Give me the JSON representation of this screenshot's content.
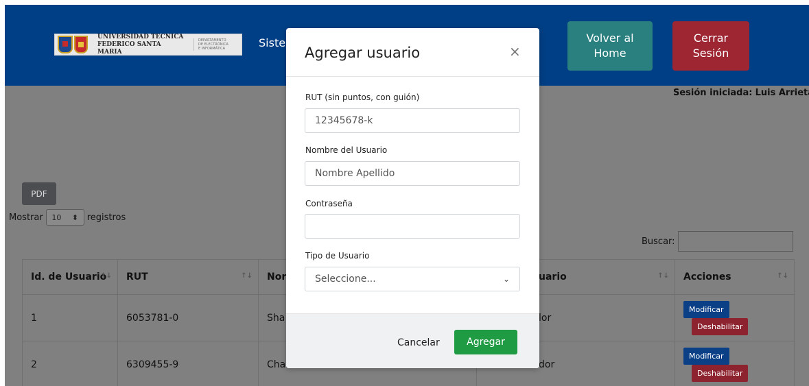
{
  "header": {
    "university_line1": "UNIVERSIDAD TECNICA",
    "university_line2": "FEDERICO SANTA MARIA",
    "department_line1": "DEPARTAMENTO",
    "department_line2": "DE ELECTRÓNICA",
    "department_line3": "E INFORMÁTICA",
    "nav_partial": "Siste",
    "home_line1": "Volver al",
    "home_line2": "Home",
    "logout_line1": "Cerrar",
    "logout_line2": "Sesión",
    "color_primary": "#003f85"
  },
  "session": {
    "label": "Sesión iniciada:",
    "user": "Luis Arrieta"
  },
  "controls": {
    "pdf_label": "PDF",
    "show_label": "Mostrar",
    "show_value": "10",
    "show_suffix": "registros",
    "search_label": "Buscar:"
  },
  "table": {
    "headers": [
      "Id. de Usuario",
      "RUT",
      "Nor",
      "uario",
      "Acciones"
    ],
    "rows": [
      {
        "id": "1",
        "rut": "6053781-0",
        "name": "Sha",
        "type": "lor"
      },
      {
        "id": "2",
        "rut": "6309455-9",
        "name": "Cha",
        "type": "dor"
      }
    ],
    "modify_label": "Modificar",
    "disable_label": "Deshabilitar"
  },
  "modal": {
    "title": "Agregar usuario",
    "rut_label": "RUT (sin puntos, con guión)",
    "rut_placeholder": "12345678-k",
    "name_label": "Nombre del Usuario",
    "name_placeholder": "Nombre Apellido",
    "password_label": "Contraseña",
    "password_value": "",
    "type_label": "Tipo de Usuario",
    "type_selected": "Seleccione...",
    "cancel_label": "Cancelar",
    "add_label": "Agregar",
    "add_color": "#1f9b44"
  }
}
